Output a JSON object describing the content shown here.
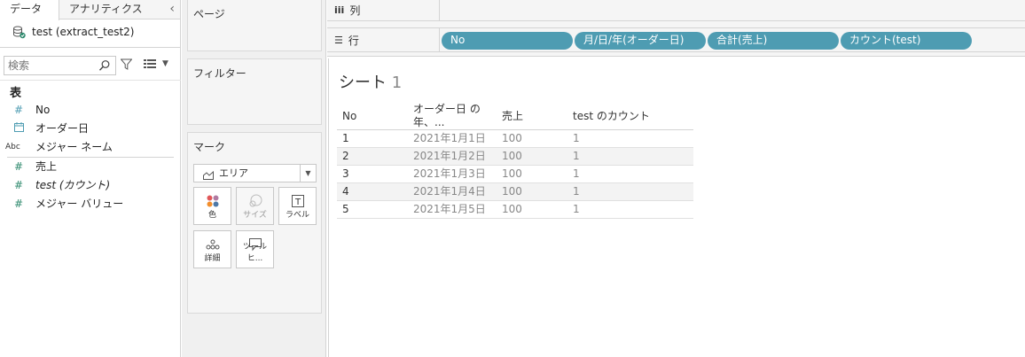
{
  "data_pane": {
    "tabs": {
      "data": "データ",
      "analytics": "アナリティクス"
    },
    "collapse_icon": "chevron-left-icon",
    "datasource": "test (extract_test2)",
    "search_placeholder": "検索",
    "table_heading": "表",
    "dimensions": [
      {
        "icon": "#",
        "icon_name": "number-icon",
        "name": "No"
      },
      {
        "icon": "date",
        "icon_name": "date-icon",
        "name": "オーダー日"
      },
      {
        "icon": "Abc",
        "icon_name": "abc-icon",
        "name": "メジャー ネーム"
      }
    ],
    "measures": [
      {
        "icon": "#",
        "icon_name": "number-icon",
        "name": "売上"
      },
      {
        "icon": "#",
        "icon_name": "number-icon",
        "name": "test (カウント)"
      },
      {
        "icon": "#",
        "icon_name": "number-icon",
        "name": "メジャー バリュー"
      }
    ]
  },
  "cards": {
    "pages": "ページ",
    "filters": "フィルター",
    "marks": "マーク",
    "mark_type": "エリア",
    "mark_buttons": {
      "color": "色",
      "size": "サイズ",
      "label": "ラベル",
      "detail": "詳細",
      "tooltip": "ツールヒ..."
    }
  },
  "shelves": {
    "columns_label": "列",
    "rows_label": "行",
    "row_pills": [
      "No",
      "月/日/年(オーダー日)",
      "合計(売上)",
      "カウント(test)"
    ]
  },
  "sheet": {
    "title": "シート",
    "title_num": "1",
    "headers": [
      "No",
      "オーダー日 の年、...",
      "売上",
      "test のカウント"
    ],
    "rows": [
      [
        "1",
        "2021年1月1日",
        "100",
        "1"
      ],
      [
        "2",
        "2021年1月2日",
        "100",
        "1"
      ],
      [
        "3",
        "2021年1月3日",
        "100",
        "1"
      ],
      [
        "4",
        "2021年1月4日",
        "100",
        "1"
      ],
      [
        "5",
        "2021年1月5日",
        "100",
        "1"
      ]
    ]
  },
  "colors": {
    "pill": "#4e9cb2",
    "field_icon": "#4e9cb2"
  }
}
